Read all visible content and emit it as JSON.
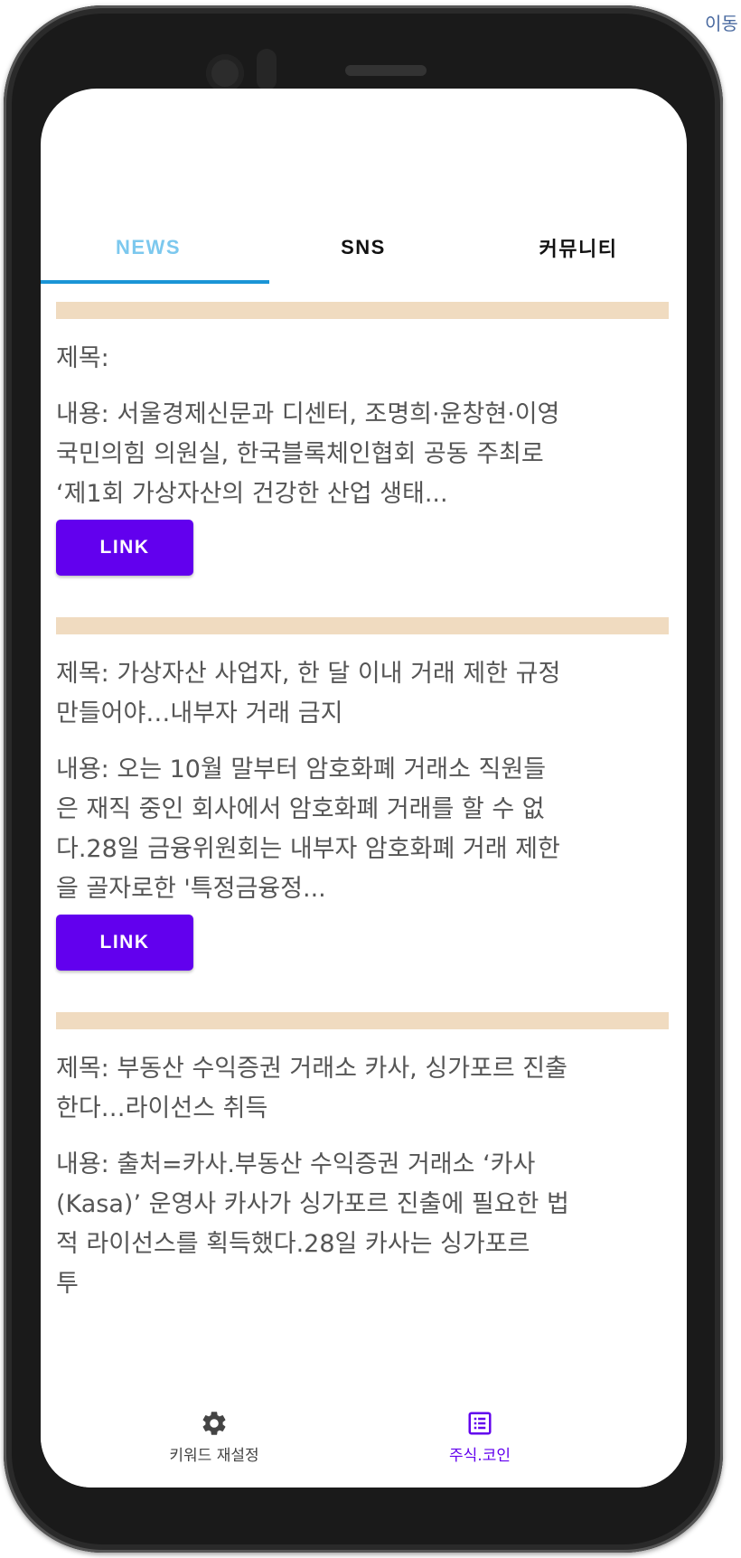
{
  "corner_text": "이동",
  "tabs": [
    {
      "label": "NEWS",
      "active": true
    },
    {
      "label": "SNS",
      "active": false
    },
    {
      "label": "커뮤니티",
      "active": false
    }
  ],
  "articles": [
    {
      "title": "제목:",
      "content_lines": [
        "내용: 서울경제신문과 디센터, 조명희·윤창현·이영",
        "국민의힘 의원실, 한국블록체인협회 공동 주최로",
        "‘제1회 가상자산의 건강한 산업 생태..."
      ],
      "link_label": "LINK"
    },
    {
      "title_lines": [
        "제목: 가상자산 사업자, 한 달 이내 거래 제한 규정",
        "만들어야…내부자 거래 금지"
      ],
      "content_lines": [
        "내용: 오는 10월 말부터 암호화폐 거래소 직원들",
        "은 재직 중인 회사에서 암호화폐 거래를 할 수 없",
        "다.28일 금융위원회는 내부자 암호화폐 거래 제한",
        "을 골자로한 '특정금융정..."
      ],
      "link_label": "LINK"
    },
    {
      "title_lines": [
        "제목: 부동산 수익증권 거래소 카사, 싱가포르 진출",
        "한다…라이선스 취득"
      ],
      "content_lines": [
        "내용: 출처=카사.부동산 수익증권 거래소 ‘카사",
        "(Kasa)’ 운영사 카사가 싱가포르 진출에 필요한 법",
        "적 라이선스를 획득했다.28일 카사는 싱가포르",
        "투"
      ]
    }
  ],
  "bottom_nav": [
    {
      "label": "키워드 재설정",
      "icon": "gear-icon",
      "color": "#444444"
    },
    {
      "label": "주식.코인",
      "icon": "list-box-icon",
      "color": "#6200ee"
    }
  ],
  "colors": {
    "accent": "#6200ee",
    "tab_active": "#7cc8ee",
    "tab_indicator": "#1a95d6",
    "divider": "#f0dbc0",
    "body_text": "#555555"
  }
}
